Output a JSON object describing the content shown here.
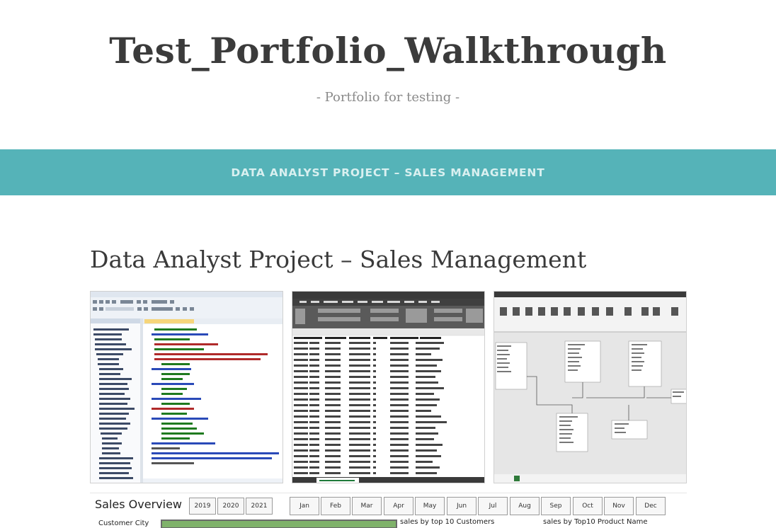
{
  "site": {
    "title": "Test_Portfolio_Walkthrough",
    "description": "- Portfolio for testing -"
  },
  "nav": {
    "items": [
      {
        "label": "DATA ANALYST PROJECT – SALES MANAGEMENT"
      }
    ]
  },
  "page": {
    "title": "Data Analyst Project – Sales Management"
  },
  "colors": {
    "nav_background": "#55b3b8",
    "nav_text": "#d9f0f0",
    "dashboard_bar": "#7fb26a"
  },
  "gallery": {
    "images": [
      {
        "name": "sql-server-screenshot"
      },
      {
        "name": "excel-customers-screenshot"
      },
      {
        "name": "power-bi-data-model-screenshot"
      }
    ]
  },
  "dashboard": {
    "title": "Sales Overview",
    "years": [
      "2019",
      "2020",
      "2021"
    ],
    "months": [
      "Jan",
      "Feb",
      "Mar",
      "Apr",
      "May",
      "Jun",
      "Jul",
      "Aug",
      "Sep",
      "Oct",
      "Nov",
      "Dec"
    ],
    "labels": {
      "customer_city": "Customer City",
      "top_customers": "sales by top 10 Customers",
      "top_products": "sales by Top10 Product Name"
    }
  }
}
